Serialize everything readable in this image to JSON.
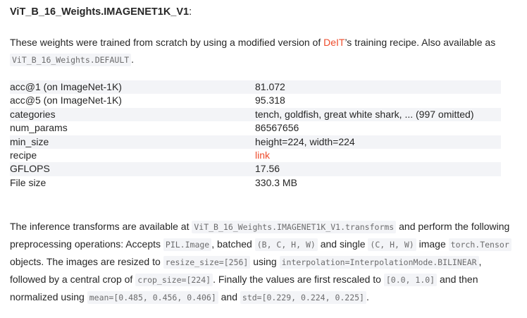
{
  "heading": {
    "name": "ViT_B_16_Weights.IMAGENET1K_V1",
    "colon": ":"
  },
  "description": {
    "prefix": "These weights were trained from scratch by using a modified version of ",
    "link_text": "DeIT",
    "middle": "’s training recipe. Also available as ",
    "code": "ViT_B_16_Weights.DEFAULT",
    "suffix": "."
  },
  "meta_table": [
    {
      "key": "acc@1 (on ImageNet-1K)",
      "value": "81.072"
    },
    {
      "key": "acc@5 (on ImageNet-1K)",
      "value": "95.318"
    },
    {
      "key": "categories",
      "value": "tench, goldfish, great white shark, ... (997 omitted)"
    },
    {
      "key": "num_params",
      "value": "86567656"
    },
    {
      "key": "min_size",
      "value": "height=224, width=224"
    },
    {
      "key": "recipe",
      "value": "link",
      "is_link": true
    },
    {
      "key": "GFLOPS",
      "value": "17.56"
    },
    {
      "key": "File size",
      "value": "330.3 MB"
    }
  ],
  "transforms": {
    "t1": "The inference transforms are available at ",
    "c1": "ViT_B_16_Weights.IMAGENET1K_V1.transforms",
    "t2": " and perform the following preprocessing operations: Accepts ",
    "c2": "PIL.Image",
    "t3": ", batched ",
    "c3": "(B, C, H, W)",
    "t4": " and single ",
    "c4": "(C, H, W)",
    "t5": " image ",
    "c5": "torch.Tensor",
    "t6": " objects. The images are resized to ",
    "c6": "resize_size=[256]",
    "t7": " using ",
    "c7": "interpolation=InterpolationMode.BILINEAR",
    "t8": ", followed by a central crop of ",
    "c8": "crop_size=[224]",
    "t9": ". Finally the values are first rescaled to ",
    "c9": "[0.0, 1.0]",
    "t10": " and then normalized using ",
    "c10": "mean=[0.485, 0.456, 0.406]",
    "t11": " and ",
    "c11": "std=[0.229, 0.224, 0.225]",
    "t12": "."
  },
  "colors": {
    "link": "#ee4c2c",
    "code_bg": "#f3f4f7",
    "code_text": "#6c6c6d",
    "row_stripe": "#f3f4f7",
    "text": "#262626"
  }
}
